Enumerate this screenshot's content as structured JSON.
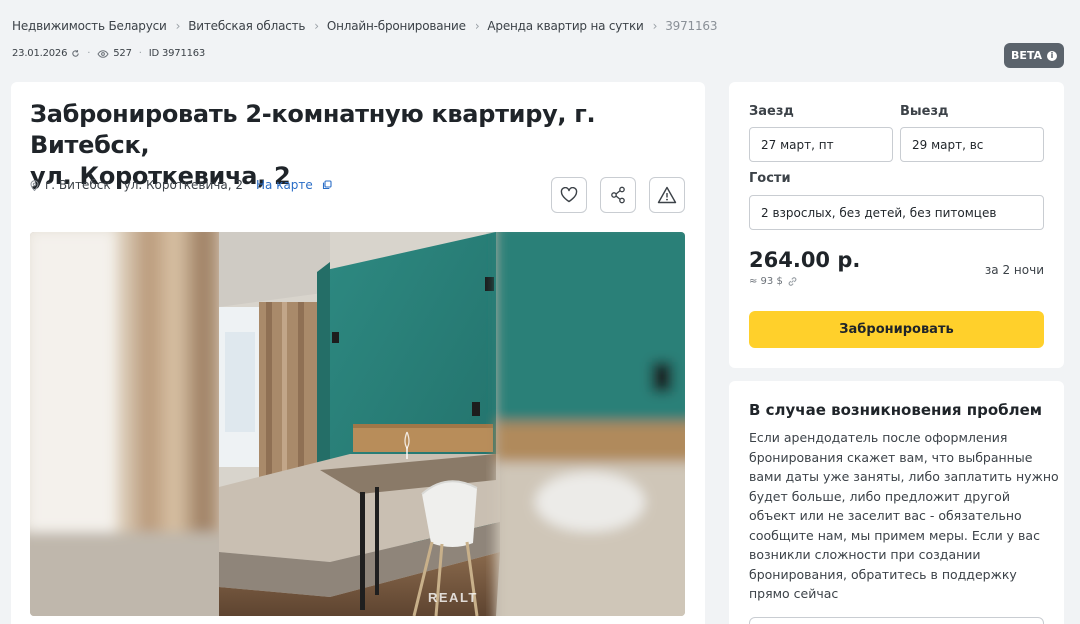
{
  "breadcrumb": [
    "Недвижимость Беларуси",
    "Витебская область",
    "Онлайн-бронирование",
    "Аренда квартир на сутки",
    "3971163"
  ],
  "meta": {
    "date": "23.01.2026",
    "views": "527",
    "id": "ID 3971163"
  },
  "beta": "BETA",
  "listing": {
    "title_line1": "Забронировать 2-комнатную квартиру, г. Витебск,",
    "title_line2": "ул. Короткевича, 2",
    "city": "г. Витебск",
    "street": "ул. Короткевича, 2",
    "map_link": "На карте",
    "watermark": "REALT"
  },
  "booking": {
    "checkin_label": "Заезд",
    "checkin_value": "27 март, пт",
    "checkout_label": "Выезд",
    "checkout_value": "29 март, вс",
    "guests_label": "Гости",
    "guests_value": "2 взрослых, без детей, без питомцев",
    "price": "264.00 р.",
    "price_usd": "≈ 93 $",
    "per": "за 2 ночи",
    "button": "Забронировать"
  },
  "problems": {
    "title": "В случае возникновения проблем",
    "lines": [
      "Если арендодатель после оформления",
      "бронирования скажет вам, что выбранные",
      "вами даты уже заняты, либо заплатить нужно",
      "будет больше, либо предложит другой",
      "объект или не заселит вас - обязательно",
      "сообщите нам, мы примем меры. Если у вас",
      "возникли сложности при создании",
      "бронирования, обратитесь в поддержку",
      "прямо сейчас"
    ]
  },
  "colors": {
    "accent": "#ffd02b",
    "link": "#2a6dc6",
    "badge": "#5b636c",
    "wall": "#2a7f77"
  }
}
